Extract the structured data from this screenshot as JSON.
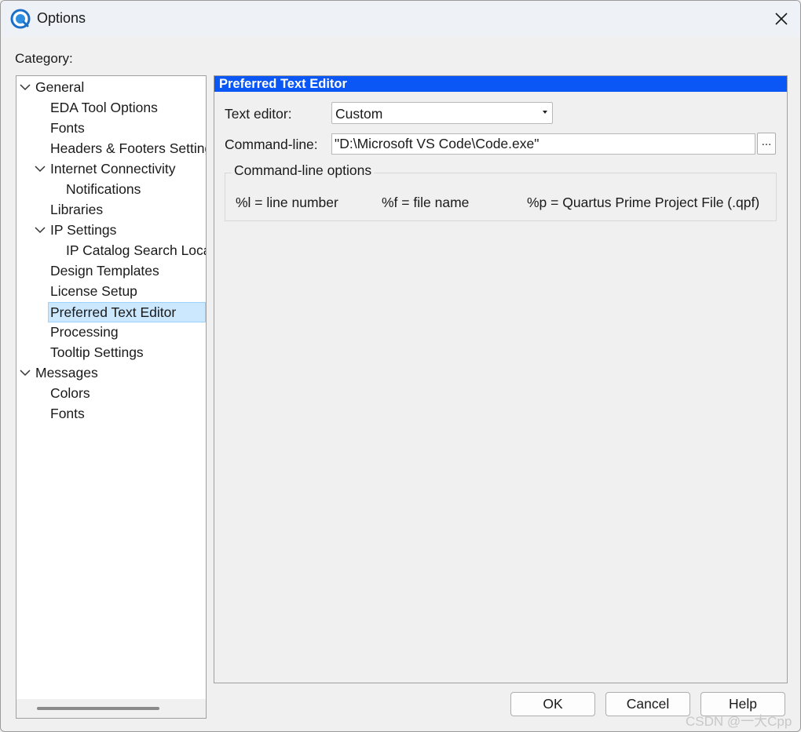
{
  "window": {
    "title": "Options"
  },
  "category_label": "Category:",
  "tree": {
    "items": [
      {
        "label": "General",
        "expanded": true
      },
      {
        "label": "EDA Tool Options"
      },
      {
        "label": "Fonts"
      },
      {
        "label": "Headers & Footers Settings"
      },
      {
        "label": "Internet Connectivity",
        "expanded": true
      },
      {
        "label": "Notifications"
      },
      {
        "label": "Libraries"
      },
      {
        "label": "IP Settings",
        "expanded": true
      },
      {
        "label": "IP Catalog Search Locations"
      },
      {
        "label": "Design Templates"
      },
      {
        "label": "License Setup"
      },
      {
        "label": "Preferred Text Editor",
        "selected": true
      },
      {
        "label": "Processing"
      },
      {
        "label": "Tooltip Settings"
      },
      {
        "label": "Messages",
        "expanded": true
      },
      {
        "label": "Colors"
      },
      {
        "label": "Fonts"
      }
    ]
  },
  "panel": {
    "header": "Preferred Text Editor",
    "text_editor_label": "Text editor:",
    "text_editor_value": "Custom",
    "command_line_label": "Command-line:",
    "command_line_value": "\"D:\\Microsoft VS Code\\Code.exe\"",
    "browse_label": "...",
    "options_group": {
      "title": "Command-line options",
      "items": [
        "%l = line number",
        "%f = file name",
        "%p = Quartus Prime Project File (.qpf)"
      ]
    }
  },
  "buttons": {
    "ok": "OK",
    "cancel": "Cancel",
    "help": "Help"
  },
  "watermark": "CSDN @一大Cpp",
  "colors": {
    "header_bg": "#0a57f5",
    "selection_bg": "#cce8ff"
  }
}
